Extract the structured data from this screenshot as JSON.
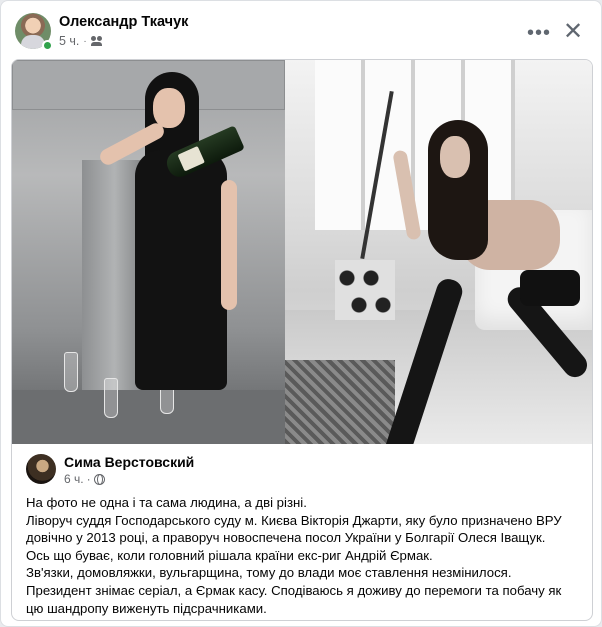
{
  "post": {
    "author": "Олександр Ткачук",
    "time": "5 ч.",
    "separator": "·",
    "audience_icon": "friends-icon",
    "more_icon": "•••",
    "close_icon": "✕"
  },
  "shared": {
    "author": "Сима Верстовский",
    "time": "6 ч.",
    "separator": "·",
    "audience_icon": "globe-icon",
    "text_lines": [
      "На фото не одна і та сама людина, а дві різні.",
      "Ліворуч суддя Господарського суду м. Києва Вікторія Джарти, яку було призначено ВРУ",
      "довічно у 2013 році, а праворуч новоспечена посол України у Болгарії Олеся Іващук.",
      "Ось що буває, коли головний рішала країни екс-риг Андрій Єрмак.",
      "Зв'язки, домовляжки, вульгарщина, тому до влади моє ставлення незмінилося.",
      "Президент знімає серіал, а Єрмак касу. Сподіваюсь я доживу до перемоги та побачу як",
      "цю шандропу виженуть підсрачниками."
    ]
  },
  "colors": {
    "online": "#31a24c",
    "secondary_text": "#65676b",
    "primary_text": "#050505"
  }
}
